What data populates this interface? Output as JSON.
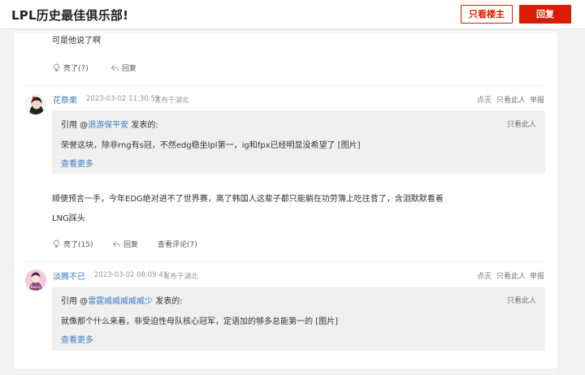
{
  "header": {
    "title": "LPL历史最佳俱乐部!",
    "only_op_label": "只看楼主",
    "reply_label": "回复"
  },
  "post_top": {
    "text": "可是他说了啊",
    "like_label": "亮了(7)",
    "reply_label": "回复"
  },
  "reply1": {
    "username": "花祭果",
    "timestamp": "2023-03-02 11:30:59",
    "location": "发布于湖北",
    "dislike": "点灭",
    "only_this": "只看此人",
    "report": "举报",
    "quote": {
      "prefix": "引用 @",
      "user": "退游保平安",
      "suffix": " 发表的:",
      "only_this": "只看此人",
      "text": "荣誉这块，除非rng有s冠，不然edg稳坐lpl第一，ig和fpx已经明显没希望了 [图片]",
      "more": "查看更多"
    },
    "body_line1": "顺便预言一手，今年EDG绝对进不了世界赛，离了韩国人这辈子都只能躺在功劳簿上吃往昔了，含泪默默看着",
    "body_line2": "LNG踩头",
    "like_label": "亮了(15)",
    "reply_label": "回复",
    "comments_label": "查看评论(7)"
  },
  "reply2": {
    "username": "淡腾不已",
    "timestamp": "2023-03-02 08:09:41",
    "location": "发布于湖北",
    "dislike": "点灭",
    "only_this": "只看此人",
    "report": "举报",
    "quote": {
      "prefix": "引用 @",
      "user": "雷霆威威威威威少",
      "suffix": " 发表的:",
      "only_this": "只看此人",
      "text": "就像那个什么来着，非受迫性母队核心冠军，定语加的够多总能第一的 [图片]",
      "more": "查看更多"
    }
  },
  "colors": {
    "accent": "#d81e06",
    "link": "#3e7cc1"
  }
}
